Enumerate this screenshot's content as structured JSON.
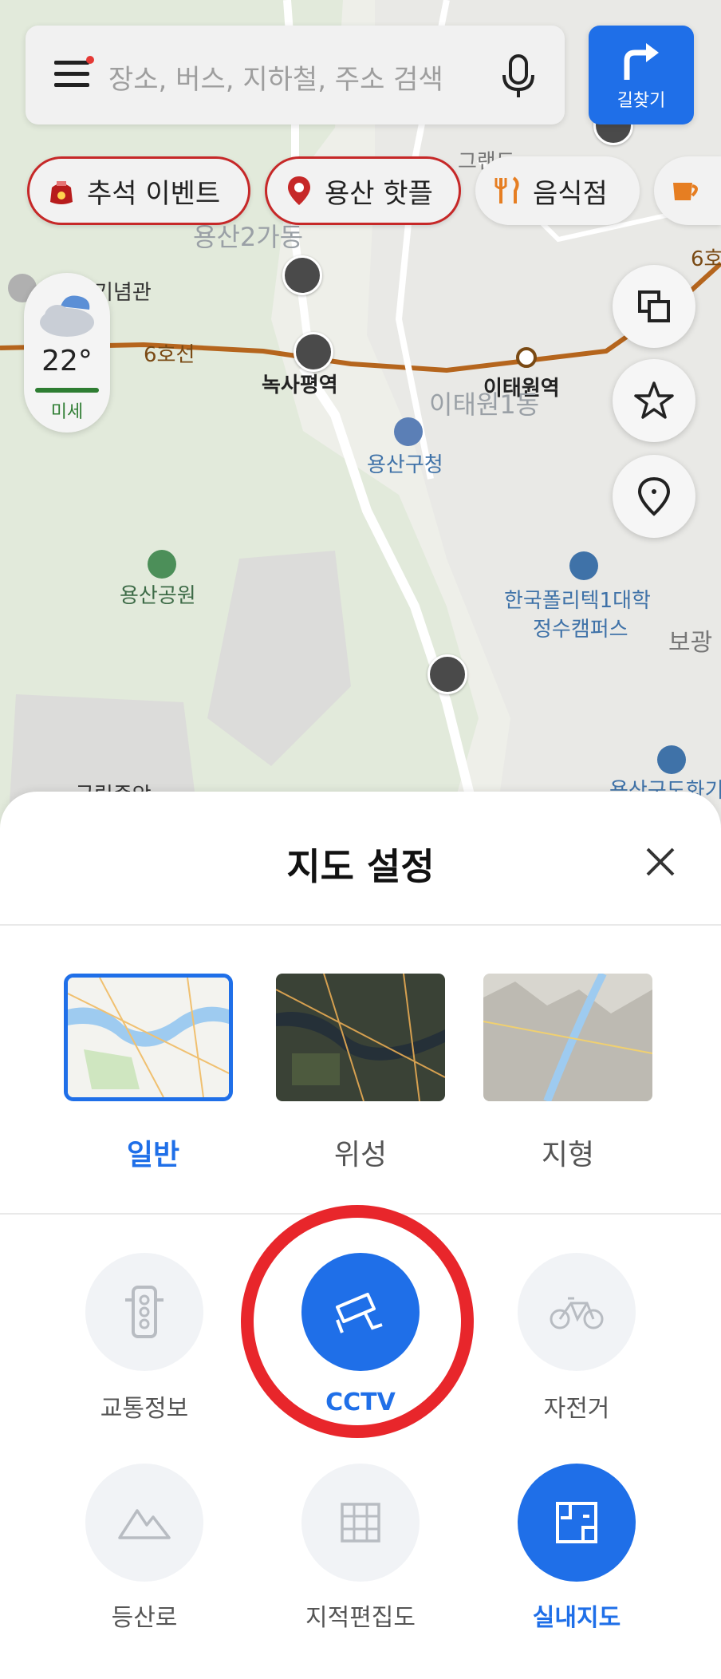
{
  "search": {
    "placeholder": "장소, 버스, 지하철, 주소 검색"
  },
  "route_button": {
    "label": "길찾기"
  },
  "chips": [
    {
      "label": "추석 이벤트"
    },
    {
      "label": "용산 핫플"
    },
    {
      "label": "음식점"
    }
  ],
  "weather": {
    "temp": "22°",
    "dust": "미세"
  },
  "map": {
    "labels": {
      "yongsan2": "용산2가동",
      "memorial": "기념관",
      "line6_left": "6호선",
      "line6_right": "6호",
      "noksapyeong": "녹사평역",
      "itaewon_station": "이태원역",
      "itaewon_dong": "이태원1동",
      "yongsan_office": "용산구청",
      "yongsan_park": "용산공원",
      "polytech_1": "한국폴리텍1대학",
      "polytech_2": "정수캠퍼스",
      "bogwang": "보광",
      "grand": "그랜드",
      "museum": "국립중앙",
      "yongsan_gu_right": "용산구도화기"
    }
  },
  "sheet": {
    "title": "지도 설정",
    "map_types": [
      {
        "label": "일반",
        "selected": true
      },
      {
        "label": "위성",
        "selected": false
      },
      {
        "label": "지형",
        "selected": false
      }
    ],
    "layers": [
      {
        "label": "교통정보",
        "icon": "traffic-light-icon",
        "on": false
      },
      {
        "label": "CCTV",
        "icon": "cctv-icon",
        "on": true
      },
      {
        "label": "자전거",
        "icon": "bicycle-icon",
        "on": false
      },
      {
        "label": "등산로",
        "icon": "mountain-icon",
        "on": false
      },
      {
        "label": "지적편집도",
        "icon": "grid-icon",
        "on": false
      },
      {
        "label": "실내지도",
        "icon": "floorplan-icon",
        "on": true
      }
    ]
  },
  "colors": {
    "accent": "#1f6fe8",
    "highlight_circle": "#e8262b",
    "line6": "#b5651d"
  }
}
